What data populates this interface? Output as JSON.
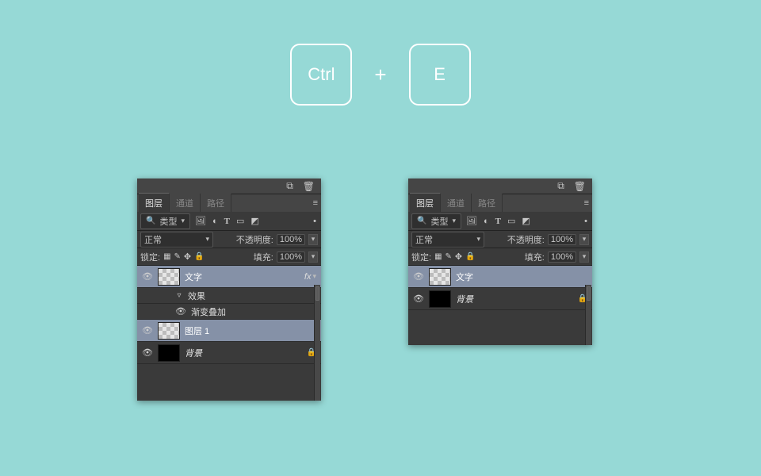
{
  "shortcut": {
    "key1": "Ctrl",
    "plus": "+",
    "key2": "E"
  },
  "panel": {
    "tabs": {
      "layers": "图层",
      "channels": "通道",
      "paths": "路径"
    },
    "filter": {
      "kind_label": "类型"
    },
    "blend": {
      "mode": "正常",
      "opacity_label": "不透明度:",
      "opacity_value": "100%"
    },
    "lock": {
      "label": "锁定:",
      "fill_label": "填充:",
      "fill_value": "100%"
    }
  },
  "left": {
    "layers": [
      {
        "name": "文字",
        "fx": "fx",
        "selected": true,
        "thumb": "checker"
      },
      {
        "sub": true,
        "toggle": "▿",
        "label": "效果"
      },
      {
        "sub": true,
        "eye": true,
        "label": "渐变叠加"
      },
      {
        "name": "图层 1",
        "selected": true,
        "thumb": "checker"
      },
      {
        "name": "背景",
        "locked": true,
        "italic": true,
        "thumb": "black"
      }
    ]
  },
  "right": {
    "layers": [
      {
        "name": "文字",
        "selected": true,
        "thumb": "checker"
      },
      {
        "name": "背景",
        "locked": true,
        "italic": true,
        "thumb": "black"
      }
    ]
  }
}
